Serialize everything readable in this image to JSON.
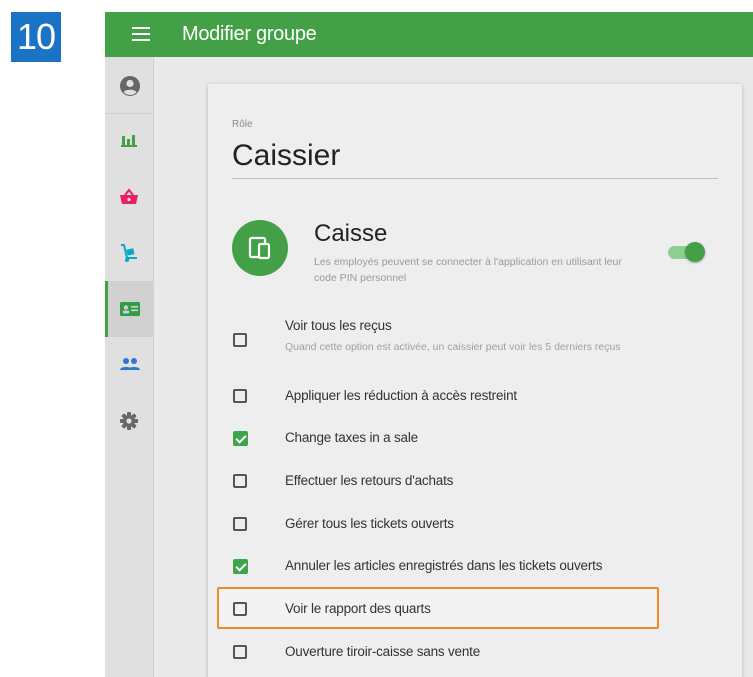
{
  "step": {
    "number": "10"
  },
  "header": {
    "title": "Modifier groupe"
  },
  "sidebar": {
    "items": [
      {
        "name": "account",
        "icon": "account-circle-icon"
      },
      {
        "name": "reports",
        "icon": "bar-chart-icon",
        "color": "#43a047"
      },
      {
        "name": "items",
        "icon": "basket-icon",
        "color": "#e91e63"
      },
      {
        "name": "inventory",
        "icon": "hand-truck-icon",
        "color": "#0aa6c9"
      },
      {
        "name": "employees",
        "icon": "employee-card-icon",
        "color": "#2e9e48",
        "active": true
      },
      {
        "name": "customers",
        "icon": "people-icon",
        "color": "#2d76d1"
      },
      {
        "name": "settings",
        "icon": "gear-icon",
        "color": "#666666"
      }
    ]
  },
  "role": {
    "label": "Rôle",
    "name": "Caissier"
  },
  "section": {
    "title": "Caisse",
    "description": "Les employés peuvent se connecter à l'application en utilisant leur code PIN personnel",
    "enabled": true
  },
  "permissions": [
    {
      "label": "Voir tous les reçus",
      "description": "Quand cette option est activée, un caissier peut voir les 5 derniers reçus",
      "checked": false
    },
    {
      "label": "Appliquer les réduction à accès restreint",
      "checked": false
    },
    {
      "label": "Change taxes in a sale",
      "checked": true
    },
    {
      "label": "Effectuer les retours d'achats",
      "checked": false
    },
    {
      "label": "Gérer tous les tickets ouverts",
      "checked": false
    },
    {
      "label": "Annuler les articles enregistrés dans les tickets ouverts",
      "checked": true
    },
    {
      "label": "Voir le rapport des quarts",
      "checked": false,
      "highlighted": true
    },
    {
      "label": "Ouverture tiroir-caisse sans vente",
      "checked": false
    }
  ],
  "colors": {
    "primary": "#43a047",
    "highlight": "#ef8a2a",
    "badge": "#1a73c5"
  }
}
